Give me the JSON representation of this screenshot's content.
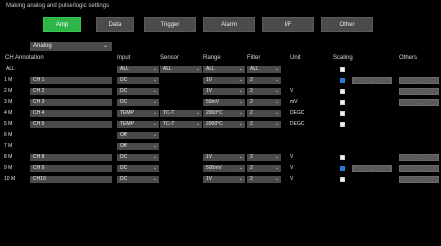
{
  "title": "Making analog and pulse/logic settings",
  "tabs": [
    {
      "label": "Amp",
      "active": true
    },
    {
      "label": "Data",
      "active": false
    },
    {
      "label": "Trigger",
      "active": false
    },
    {
      "label": "Alarm",
      "active": false
    },
    {
      "label": "I/F",
      "active": false
    },
    {
      "label": "Other",
      "active": false
    }
  ],
  "mode_select": "Analog",
  "headers": {
    "ch": "CH",
    "annotation": "Annotation",
    "input": "Input",
    "sensor": "Sensor",
    "range": "Range",
    "filter": "Filter",
    "unit": "Unit",
    "scaling": "Scaling",
    "others": "Others"
  },
  "all_row": {
    "ch": "ALL",
    "input": "ALL",
    "sensor": "ALL",
    "range": "ALL",
    "filter": "ALL"
  },
  "rows": [
    {
      "ch": "1 M",
      "annotation": "CH 1",
      "input": "DC",
      "sensor": "",
      "range": "1V",
      "filter": "2",
      "unit": "",
      "scaling_visible": true,
      "scaling": true,
      "scaling_btn": true,
      "others_btn": true
    },
    {
      "ch": "2 M",
      "annotation": "CH 2",
      "input": "DC",
      "sensor": "",
      "range": "1V",
      "filter": "2",
      "unit": "V",
      "scaling_visible": true,
      "scaling": false,
      "scaling_btn": false,
      "others_btn": true
    },
    {
      "ch": "3 M",
      "annotation": "CH 3",
      "input": "DC",
      "sensor": "",
      "range": "50mV",
      "filter": "2",
      "unit": "mV",
      "scaling_visible": true,
      "scaling": false,
      "scaling_btn": false,
      "others_btn": true
    },
    {
      "ch": "4 M",
      "annotation": "CH 4",
      "input": "TEMP",
      "sensor": "TC-T",
      "range": "2000°C",
      "filter": "2",
      "unit": "DEGC",
      "scaling_visible": true,
      "scaling": false,
      "scaling_btn": false,
      "others_btn": false
    },
    {
      "ch": "5 M",
      "annotation": "CH 5",
      "input": "TEMP",
      "sensor": "TC-T",
      "range": "2000°C",
      "filter": "2",
      "unit": "DEGC",
      "scaling_visible": true,
      "scaling": false,
      "scaling_btn": false,
      "others_btn": false
    },
    {
      "ch": "6 M",
      "annotation": "",
      "input": "Off",
      "sensor": "",
      "range": "",
      "filter": "",
      "unit": "",
      "scaling_visible": false,
      "scaling": false,
      "scaling_btn": false,
      "others_btn": false
    },
    {
      "ch": "7 M",
      "annotation": "",
      "input": "Off",
      "sensor": "",
      "range": "",
      "filter": "",
      "unit": "",
      "scaling_visible": false,
      "scaling": false,
      "scaling_btn": false,
      "others_btn": false
    },
    {
      "ch": "8 M",
      "annotation": "CH 8",
      "input": "DC",
      "sensor": "",
      "range": "1V",
      "filter": "2",
      "unit": "V",
      "scaling_visible": true,
      "scaling": false,
      "scaling_btn": false,
      "others_btn": true
    },
    {
      "ch": "9 M",
      "annotation": "CH 9",
      "input": "DC",
      "sensor": "",
      "range": "500mV",
      "filter": "2",
      "unit": "V",
      "scaling_visible": true,
      "scaling": true,
      "scaling_btn": true,
      "others_btn": true
    },
    {
      "ch": "10 M",
      "annotation": "CH10",
      "input": "DC",
      "sensor": "",
      "range": "1V",
      "filter": "2",
      "unit": "V",
      "scaling_visible": true,
      "scaling": false,
      "scaling_btn": false,
      "others_btn": true
    }
  ],
  "colors": {
    "active_tab": "#2fb44a",
    "field": "#4a4a4a",
    "checkbox_checked": "#2b7bd8",
    "background": "#000000"
  },
  "icons": {
    "dropdown": "chevron-down-icon",
    "more_button": "ellipsis-icon"
  }
}
